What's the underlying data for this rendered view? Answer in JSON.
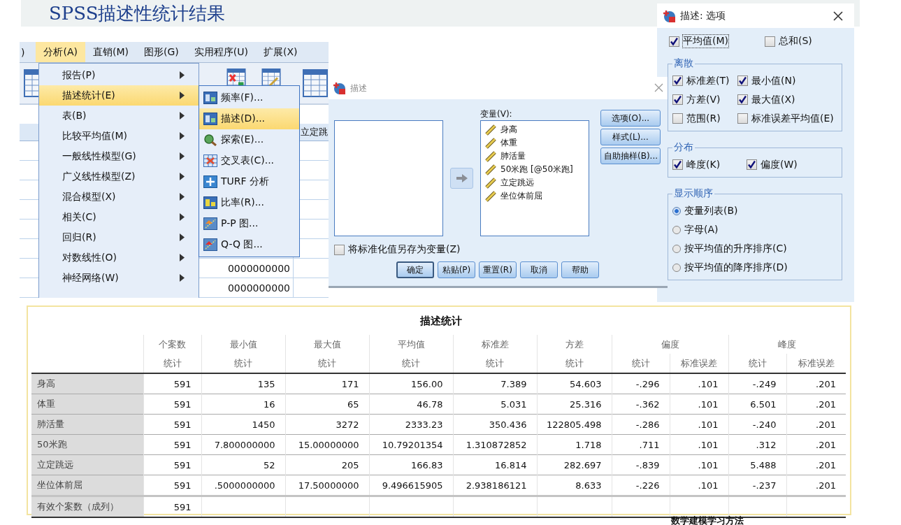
{
  "title": "SPSS描述性统计结果",
  "spss_window": {
    "menubar": [
      {
        "label": ")",
        "selected": false
      },
      {
        "label": "分析(A)",
        "selected": true
      },
      {
        "label": "直销(M)",
        "selected": false
      },
      {
        "label": "图形(G)",
        "selected": false
      },
      {
        "label": "实用程序(U)",
        "selected": false
      },
      {
        "label": "扩展(X)",
        "selected": false
      }
    ],
    "grid": {
      "column_header": "立定跳",
      "values": [
        "0000000000",
        "0000000000"
      ]
    },
    "menu": [
      {
        "label": "报告(P)",
        "selected": false
      },
      {
        "label": "描述统计(E)",
        "selected": true
      },
      {
        "label": "表(B)",
        "selected": false
      },
      {
        "label": "比较平均值(M)",
        "selected": false
      },
      {
        "label": "一般线性模型(G)",
        "selected": false
      },
      {
        "label": "广义线性模型(Z)",
        "selected": false
      },
      {
        "label": "混合模型(X)",
        "selected": false
      },
      {
        "label": "相关(C)",
        "selected": false
      },
      {
        "label": "回归(R)",
        "selected": false
      },
      {
        "label": "对数线性(O)",
        "selected": false
      },
      {
        "label": "神经网络(W)",
        "selected": false
      }
    ],
    "submenu": [
      {
        "label": "频率(F)...",
        "selected": false
      },
      {
        "label": "描述(D)...",
        "selected": true
      },
      {
        "label": "探索(E)...",
        "selected": false
      },
      {
        "label": "交叉表(C)...",
        "selected": false
      },
      {
        "label": "TURF 分析",
        "selected": false
      },
      {
        "label": "比率(R)...",
        "selected": false
      },
      {
        "label": "P-P 图...",
        "selected": false
      },
      {
        "label": "Q-Q 图...",
        "selected": false
      }
    ]
  },
  "describe_dialog": {
    "title": "描述",
    "variables_label": "变量(V):",
    "variables": [
      "身高",
      "体重",
      "肺活量",
      "50米跑 [@50米跑]",
      "立定跳远",
      "坐位体前屈"
    ],
    "side_buttons": [
      "选项(O)...",
      "样式(L)...",
      "自助抽样(B)..."
    ],
    "save_checkbox": {
      "label": "将标准化值另存为变量(Z)",
      "checked": false
    },
    "buttons": [
      {
        "label": "确定",
        "default": true
      },
      {
        "label": "粘贴(P)",
        "default": false
      },
      {
        "label": "重置(R)",
        "default": false
      },
      {
        "label": "取消",
        "default": false
      },
      {
        "label": "帮助",
        "default": false
      }
    ]
  },
  "options_dialog": {
    "title": "描述: 选项",
    "top": [
      {
        "label": "平均值(M)",
        "checked": true,
        "focused": true
      },
      {
        "label": "总和(S)",
        "checked": false,
        "focused": false
      }
    ],
    "groups": [
      {
        "title": "离散",
        "kind": "checkboxes",
        "items": [
          {
            "label": "标准差(T)",
            "checked": true
          },
          {
            "label": "最小值(N)",
            "checked": true
          },
          {
            "label": "方差(V)",
            "checked": true
          },
          {
            "label": "最大值(X)",
            "checked": true
          },
          {
            "label": "范围(R)",
            "checked": false
          },
          {
            "label": "标准误差平均值(E)",
            "checked": false
          }
        ]
      },
      {
        "title": "分布",
        "kind": "checkboxes",
        "items": [
          {
            "label": "峰度(K)",
            "checked": true
          },
          {
            "label": "偏度(W)",
            "checked": true
          }
        ]
      },
      {
        "title": "显示顺序",
        "kind": "radios",
        "items": [
          {
            "label": "变量列表(B)",
            "selected": true
          },
          {
            "label": "字母(A)",
            "selected": false
          },
          {
            "label": "按平均值的升序排序(C)",
            "selected": false
          },
          {
            "label": "按平均值的降序排序(D)",
            "selected": false
          }
        ]
      }
    ]
  },
  "statistics_table": {
    "title": "描述统计",
    "columns": [
      {
        "label": "个案数",
        "sub": [
          "统计"
        ]
      },
      {
        "label": "最小值",
        "sub": [
          "统计"
        ]
      },
      {
        "label": "最大值",
        "sub": [
          "统计"
        ]
      },
      {
        "label": "平均值",
        "sub": [
          "统计"
        ]
      },
      {
        "label": "标准差",
        "sub": [
          "统计"
        ]
      },
      {
        "label": "方差",
        "sub": [
          "统计"
        ]
      },
      {
        "label": "偏度",
        "sub": [
          "统计",
          "标准误差"
        ]
      },
      {
        "label": "峰度",
        "sub": [
          "统计",
          "标准误差"
        ]
      }
    ],
    "rows": [
      {
        "label": "身高",
        "values": [
          "591",
          "135",
          "171",
          "156.00",
          "7.389",
          "54.603",
          "-.296",
          ".101",
          "-.249",
          ".201"
        ]
      },
      {
        "label": "体重",
        "values": [
          "591",
          "16",
          "65",
          "46.78",
          "5.031",
          "25.316",
          "-.362",
          ".101",
          "6.501",
          ".201"
        ]
      },
      {
        "label": "肺活量",
        "values": [
          "591",
          "1450",
          "3272",
          "2333.23",
          "350.436",
          "122805.498",
          "-.286",
          ".101",
          "-.240",
          ".201"
        ]
      },
      {
        "label": "50米跑",
        "values": [
          "591",
          "7.800000000",
          "15.00000000",
          "10.79201354",
          "1.310872852",
          "1.718",
          ".711",
          ".101",
          ".312",
          ".201"
        ]
      },
      {
        "label": "立定跳远",
        "values": [
          "591",
          "52",
          "205",
          "166.83",
          "16.814",
          "282.697",
          "-.839",
          ".101",
          "5.488",
          ".201"
        ]
      },
      {
        "label": "坐位体前屈",
        "values": [
          "591",
          ".5000000000",
          "17.50000000",
          "9.496615905",
          "2.938186121",
          "8.633",
          "-.226",
          ".101",
          "-.237",
          ".201"
        ]
      },
      {
        "label": "有效个案数（成列）",
        "values": [
          "591"
        ]
      }
    ]
  },
  "footer_heading": "数学建模学习方法"
}
